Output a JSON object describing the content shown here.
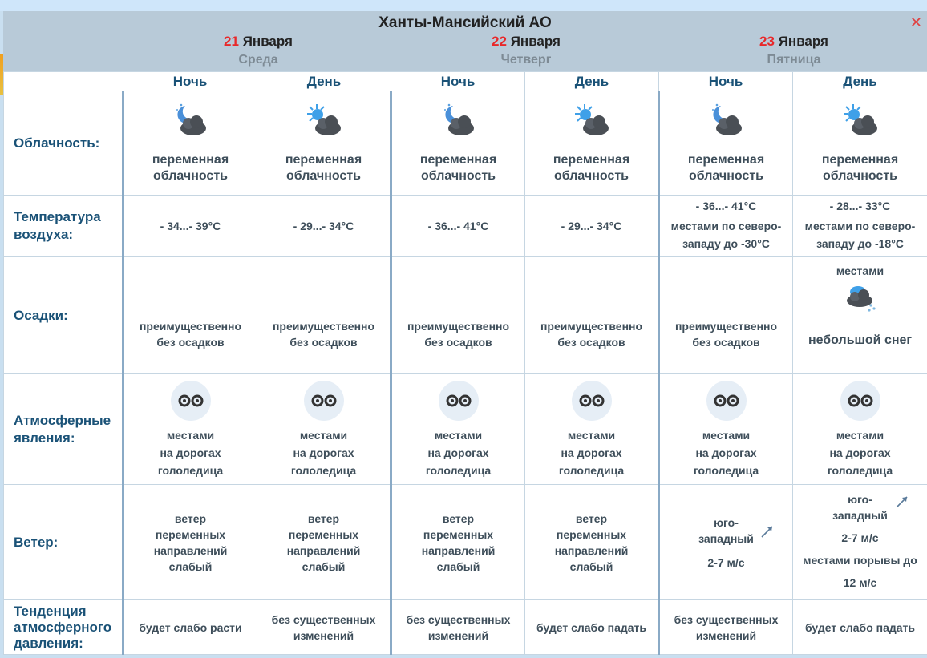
{
  "region": "Ханты-Мансийский АО",
  "close_icon": "close-icon",
  "days": [
    {
      "num": "21",
      "month": "Января",
      "weekday": "Среда"
    },
    {
      "num": "22",
      "month": "Января",
      "weekday": "Четверг"
    },
    {
      "num": "23",
      "month": "Января",
      "weekday": "Пятница"
    }
  ],
  "periods": [
    "Ночь",
    "День",
    "Ночь",
    "День",
    "Ночь",
    "День"
  ],
  "labels": {
    "cloud": "Облачность:",
    "temp1": "Температура",
    "temp2": "воздуха:",
    "precip": "Осадки:",
    "atm1": "Атмосферные",
    "atm2": "явления:",
    "wind": "Ветер:",
    "press1": "Тенденция",
    "press2": "атмосферного",
    "press3": "давления:"
  },
  "cloud": [
    {
      "icon": "moon-cloud-icon",
      "l1": "переменная",
      "l2": "облачность"
    },
    {
      "icon": "sun-cloud-icon",
      "l1": "переменная",
      "l2": "облачность"
    },
    {
      "icon": "moon-cloud-icon",
      "l1": "переменная",
      "l2": "облачность"
    },
    {
      "icon": "sun-cloud-icon",
      "l1": "переменная",
      "l2": "облачность"
    },
    {
      "icon": "moon-cloud-icon",
      "l1": "переменная",
      "l2": "облачность"
    },
    {
      "icon": "sun-cloud-icon",
      "l1": "переменная",
      "l2": "облачность"
    }
  ],
  "temp": [
    {
      "main": "- 34...- 39°C",
      "n1": "",
      "n2": ""
    },
    {
      "main": "- 29...- 34°C",
      "n1": "",
      "n2": ""
    },
    {
      "main": "- 36...- 41°C",
      "n1": "",
      "n2": ""
    },
    {
      "main": "- 29...- 34°C",
      "n1": "",
      "n2": ""
    },
    {
      "main": "- 36...- 41°C",
      "n1": "местами по северо-",
      "n2": "западу до -30°C"
    },
    {
      "main": "- 28...- 33°C",
      "n1": "местами по северо-",
      "n2": "западу до -18°C"
    }
  ],
  "precip": [
    {
      "top": "",
      "l1": "преимущественно",
      "l2": "без осадков"
    },
    {
      "top": "",
      "l1": "преимущественно",
      "l2": "без осадков"
    },
    {
      "top": "",
      "l1": "преимущественно",
      "l2": "без осадков"
    },
    {
      "top": "",
      "l1": "преимущественно",
      "l2": "без осадков"
    },
    {
      "top": "",
      "l1": "преимущественно",
      "l2": "без осадков"
    },
    {
      "top": "местами",
      "l1": "небольшой снег",
      "l2": "",
      "icon": "snow-cloud-icon"
    }
  ],
  "atm": [
    {
      "icon": "ice-icon",
      "l1": "местами",
      "l2": "на дорогах",
      "l3": "гололедица"
    },
    {
      "icon": "ice-icon",
      "l1": "местами",
      "l2": "на дорогах",
      "l3": "гололедица"
    },
    {
      "icon": "ice-icon",
      "l1": "местами",
      "l2": "на дорогах",
      "l3": "гололедица"
    },
    {
      "icon": "ice-icon",
      "l1": "местами",
      "l2": "на дорогах",
      "l3": "гололедица"
    },
    {
      "icon": "ice-icon",
      "l1": "местами",
      "l2": "на дорогах",
      "l3": "гололедица"
    },
    {
      "icon": "ice-icon",
      "l1": "местами",
      "l2": "на дорогах",
      "l3": "гололедица"
    }
  ],
  "wind_var": [
    {
      "l1": "ветер",
      "l2": "переменных",
      "l3": "направлений",
      "l4": "слабый"
    },
    {
      "l1": "ветер",
      "l2": "переменных",
      "l3": "направлений",
      "l4": "слабый"
    },
    {
      "l1": "ветер",
      "l2": "переменных",
      "l3": "направлений",
      "l4": "слабый"
    },
    {
      "l1": "ветер",
      "l2": "переменных",
      "l3": "направлений",
      "l4": "слабый"
    }
  ],
  "wind_dir": [
    {
      "l1": "юго-",
      "l2": "западный",
      "speed": "2-7 м/с",
      "g1": "",
      "g2": "",
      "arrow": "wind-arrow-icon"
    },
    {
      "l1": "юго-",
      "l2": "западный",
      "speed": "2-7 м/с",
      "g1": "местами порывы до",
      "g2": "12 м/с",
      "arrow": "wind-arrow-icon"
    }
  ],
  "pressure": [
    {
      "l1": "будет слабо расти",
      "l2": ""
    },
    {
      "l1": "без существенных",
      "l2": "изменений"
    },
    {
      "l1": "без существенных",
      "l2": "изменений"
    },
    {
      "l1": "будет слабо падать",
      "l2": ""
    },
    {
      "l1": "без существенных",
      "l2": "изменений"
    },
    {
      "l1": "будет слабо падать",
      "l2": ""
    }
  ]
}
